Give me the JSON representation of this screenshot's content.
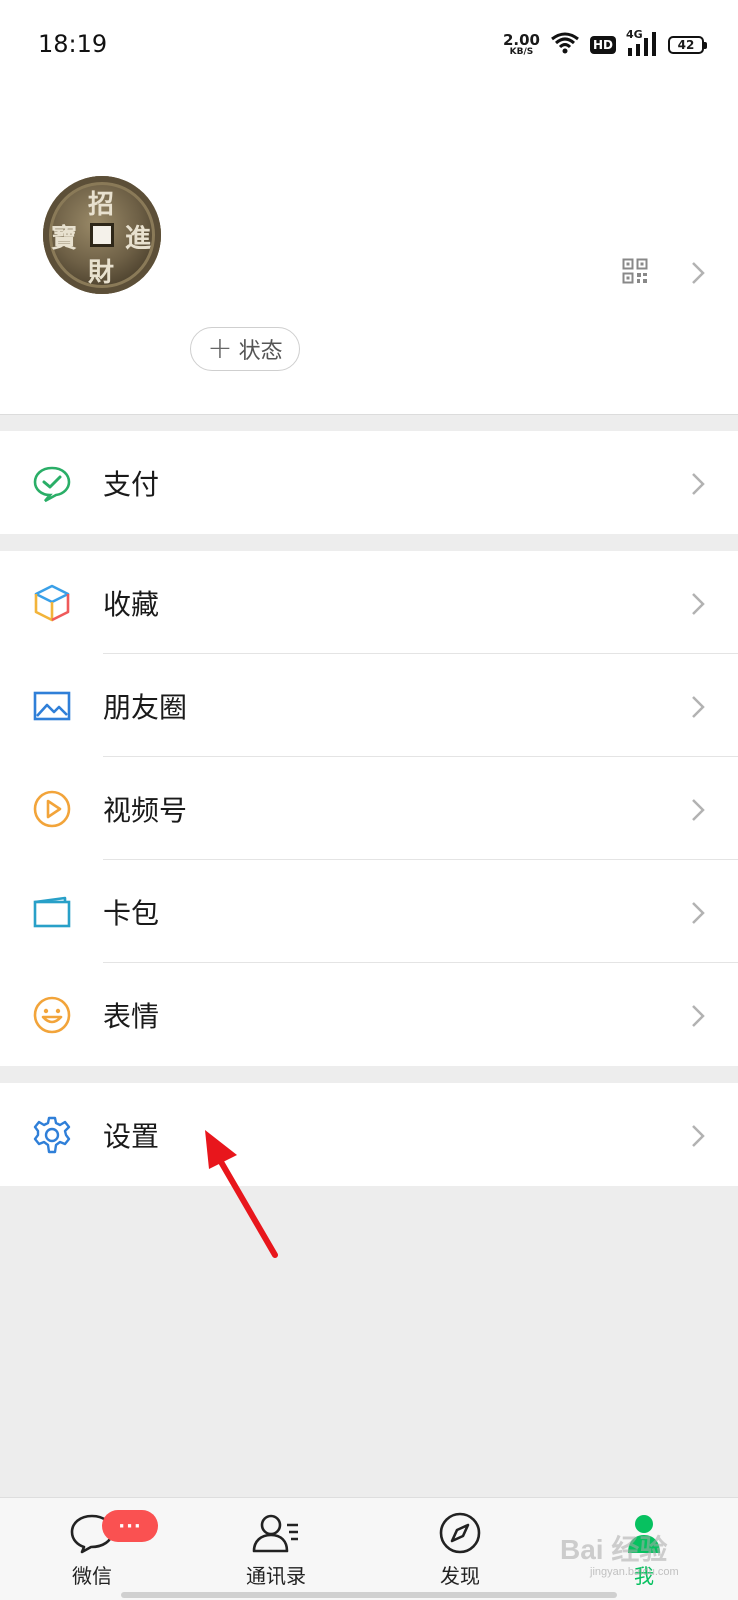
{
  "status_bar": {
    "time": "18:19",
    "net_speed_value": "2.00",
    "net_speed_unit": "KB/S",
    "hd_label": "HD",
    "network_label": "4G",
    "battery_level": "42"
  },
  "profile": {
    "avatar_text": [
      "招",
      "進",
      "財",
      "寶"
    ],
    "status_button_label": "状态"
  },
  "menu": {
    "pay": "支付",
    "favorites": "收藏",
    "moments": "朋友圈",
    "channels": "视频号",
    "cards": "卡包",
    "stickers": "表情",
    "settings": "设置"
  },
  "tabbar": {
    "chats": "微信",
    "contacts": "通讯录",
    "discover": "发现",
    "me": "我",
    "chats_badge": "···"
  },
  "watermark": {
    "brand": "Bai 经验",
    "url": "jingyan.baidu.com"
  },
  "colors": {
    "active_tab": "#07c160",
    "badge": "#fa5151",
    "annotation_arrow": "#e8161c",
    "settings_icon": "#2f7fd8"
  }
}
